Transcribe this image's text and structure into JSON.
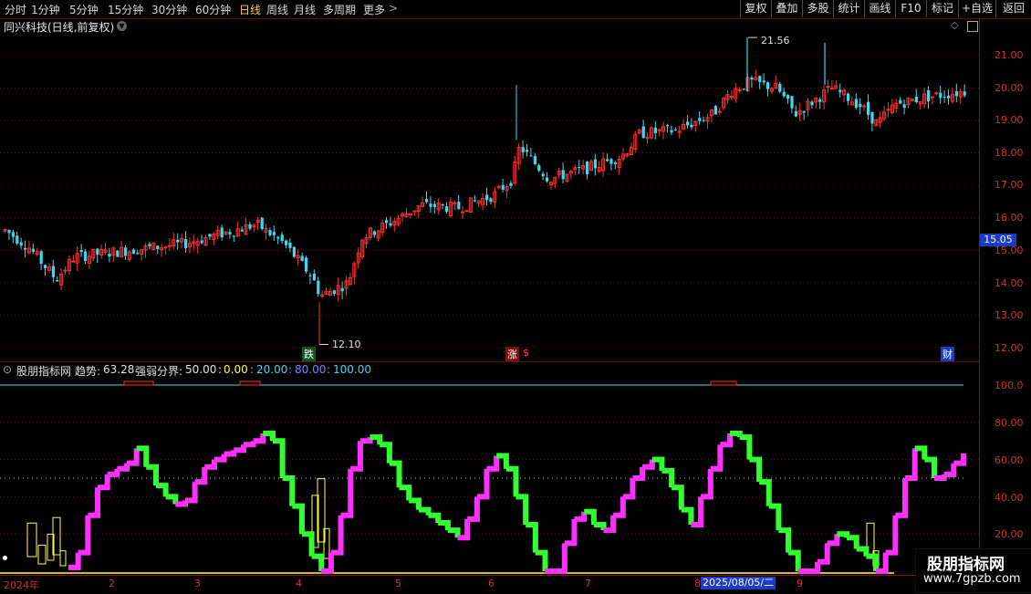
{
  "toolbar": {
    "periods": [
      "分时",
      "1分钟",
      "5分钟",
      "15分钟",
      "30分钟",
      "60分钟",
      "日线",
      "周线",
      "月线",
      "多周期",
      "更多"
    ],
    "active_period": "日线",
    "more_arrow": ">",
    "buttons": [
      "复权",
      "叠加",
      "多股",
      "统计",
      "画线",
      "F10",
      "标记",
      "+自选",
      "返回"
    ]
  },
  "stock": {
    "title": "同兴科技(日线,前复权)"
  },
  "price_axis": {
    "ticks": [
      "21.00",
      "20.00",
      "19.00",
      "18.00",
      "17.00",
      "16.00",
      "15.00",
      "14.00",
      "13.00",
      "12.00"
    ],
    "current": "15.05"
  },
  "price_annotations": {
    "high": "21.56",
    "low": "12.10"
  },
  "event_marks": {
    "fall": "跌",
    "rise": "涨",
    "dollar": "$",
    "finance": "财"
  },
  "indicator": {
    "name": "股朋指标网",
    "trend_label": "趋势:",
    "trend_value": "63.28",
    "boundary_label": "强弱分界:",
    "boundary_value": "50.00",
    "levels": [
      ":",
      "0.00",
      ":",
      "20.00",
      ":",
      "80.00",
      ":",
      "100.00"
    ],
    "axis": [
      "100.0",
      "80.00",
      "60.00",
      "40.00",
      "20.00"
    ]
  },
  "date_axis": {
    "labels": [
      "2024年",
      "2",
      "3",
      "4",
      "5",
      "6",
      "7",
      "8",
      "9"
    ],
    "cursor": "2025/08/05/二"
  },
  "watermark": {
    "title": "股朋指标网",
    "url": "www.7gpzb.com"
  },
  "colors": {
    "up": "#ff3030",
    "down": "#40d8f0",
    "trend_up": "#ff30ff",
    "trend_down": "#30ff30",
    "axis": "#d03030",
    "volume": "#ffff40"
  },
  "chart_data": {
    "type": "candlestick",
    "price_range": [
      12.0,
      21.56
    ],
    "trend_series_approx": [
      2,
      10,
      30,
      45,
      52,
      55,
      58,
      66,
      56,
      46,
      40,
      36,
      38,
      48,
      56,
      60,
      63,
      65,
      68,
      70,
      74,
      70,
      50,
      35,
      20,
      8,
      0,
      10,
      30,
      55,
      70,
      72,
      68,
      58,
      45,
      38,
      33,
      30,
      26,
      22,
      18,
      28,
      40,
      55,
      62,
      55,
      40,
      25,
      10,
      0,
      0,
      15,
      28,
      32,
      25,
      22,
      30,
      40,
      50,
      56,
      60,
      54,
      45,
      33,
      25,
      40,
      55,
      68,
      74,
      72,
      60,
      48,
      35,
      22,
      10,
      0,
      0,
      5,
      15,
      20,
      18,
      12,
      8,
      0,
      10,
      30,
      50,
      66,
      60,
      50,
      52,
      58,
      63.28
    ]
  }
}
